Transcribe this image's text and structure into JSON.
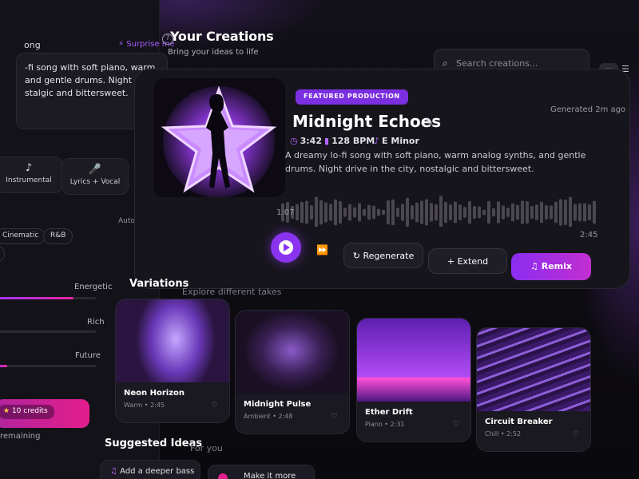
{
  "sidebar": {
    "title": "ong",
    "surprise_label": "Surprise me",
    "prompt_text": "-fi song with soft piano, warm and gentle drums. Night drive stalgic and bittersweet.",
    "modes": [
      {
        "label": "Instrumental",
        "icon": "music-note-icon"
      },
      {
        "label": "Lyrics + Vocal",
        "icon": "microphone-icon"
      }
    ],
    "auto_label": "Auto",
    "chips": [
      "Cinematic",
      "R&B"
    ],
    "sliders": [
      {
        "label": "Energetic",
        "value": 0.78
      },
      {
        "label": "Rich",
        "value": 0
      },
      {
        "label": "Future",
        "value": 0.12
      }
    ],
    "credits_label": "10 credits",
    "remaining_label": "remaining"
  },
  "header": {
    "title": "Your Creations",
    "subtitle": "Bring your ideas to life",
    "search_placeholder": "Search creations..."
  },
  "featured": {
    "badge": "FEATURED PRODUCTION",
    "generated": "Generated 2m ago",
    "title": "Midnight Echoes",
    "duration": "3:42",
    "bpm": "128 BPM",
    "key": "E Minor",
    "description": "A dreamy lo-fi song with soft piano, warm analog synths, and gentle drums. Night drive in the city, nostalgic and bittersweet.",
    "time_current": "1:07",
    "time_total": "2:45",
    "progress": 0.0,
    "actions": {
      "regenerate": "Regenerate",
      "extend": "Extend",
      "remix": "Remix"
    }
  },
  "variations": {
    "title": "Variations",
    "subtitle": "Explore different takes",
    "items": [
      {
        "name": "Neon Horizon",
        "meta": "Warm • 2:45"
      },
      {
        "name": "Midnight Pulse",
        "meta": "Ambient • 2:48"
      },
      {
        "name": "Ether Drift",
        "meta": "Piano • 2:31"
      },
      {
        "name": "Circuit Breaker",
        "meta": "Chill • 2:52"
      }
    ]
  },
  "suggested": {
    "title": "Suggested Ideas",
    "subtitle": "For you",
    "items": [
      "Add a deeper bass",
      "Make it more"
    ]
  },
  "colors": {
    "accent": "#8a34f0",
    "pink": "#e41e8c"
  }
}
